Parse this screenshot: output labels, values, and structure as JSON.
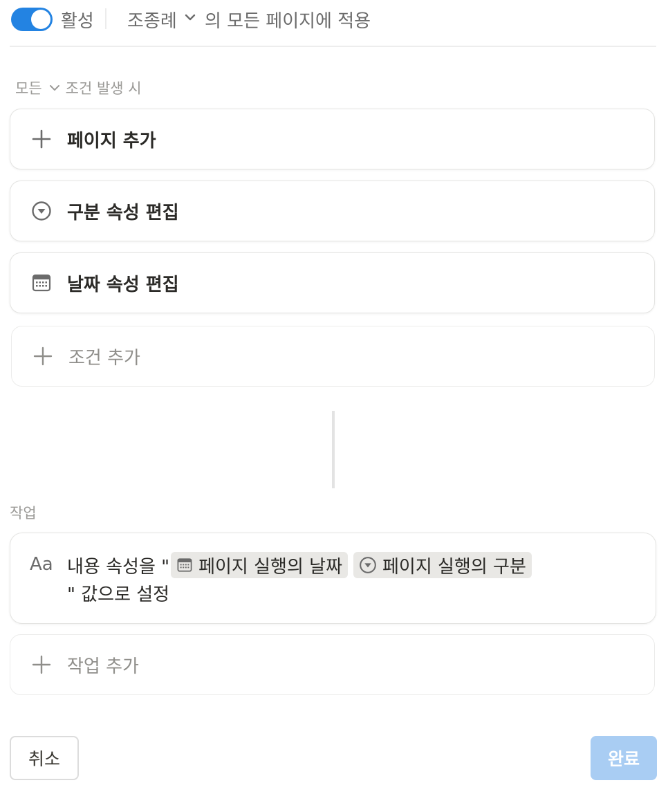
{
  "header": {
    "toggle_on": true,
    "active_label": "활성",
    "database_name": "조종례",
    "apply_suffix": "의 모든 페이지에 적용"
  },
  "conditions": {
    "match_mode": "모든",
    "heading_suffix": "조건 발생 시",
    "items": [
      {
        "icon": "plus-icon",
        "label": "페이지 추가"
      },
      {
        "icon": "select-property-icon",
        "label": "구분 속성 편집"
      },
      {
        "icon": "calendar-icon",
        "label": "날짜 속성 편집"
      }
    ],
    "add_label": "조건 추가"
  },
  "actions": {
    "heading": "작업",
    "item": {
      "icon_text": "Aa",
      "prefix": "내용 속성을 \"",
      "chip_date": "페이지 실행의 날짜",
      "chip_category": "페이지 실행의 구분",
      "suffix": "\" 값으로 설정"
    },
    "add_label": "작업 추가"
  },
  "footer": {
    "cancel_label": "취소",
    "done_label": "완료"
  },
  "colors": {
    "accent": "#2383e2",
    "done_disabled": "#a9cdf3",
    "chip_bg": "#e9e8e5"
  }
}
